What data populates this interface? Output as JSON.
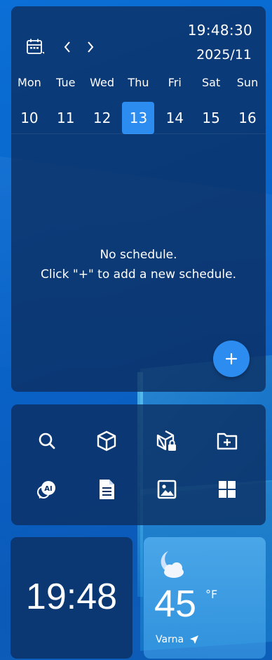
{
  "calendar": {
    "current_time": "19:48:30",
    "current_month": "2025/11",
    "days": [
      {
        "name": "Mon",
        "num": "10"
      },
      {
        "name": "Tue",
        "num": "11"
      },
      {
        "name": "Wed",
        "num": "12"
      },
      {
        "name": "Thu",
        "num": "13"
      },
      {
        "name": "Fri",
        "num": "14"
      },
      {
        "name": "Sat",
        "num": "15"
      },
      {
        "name": "Sun",
        "num": "16"
      }
    ],
    "selected_day": "13",
    "empty_line1": "No schedule.",
    "empty_line2": "Click \"+\" to add a new schedule.",
    "add_label": "+"
  },
  "tools": [
    {
      "icon": "search-icon"
    },
    {
      "icon": "cube-icon"
    },
    {
      "icon": "cube-lock-icon"
    },
    {
      "icon": "folder-add-icon"
    },
    {
      "icon": "ai-chat-icon"
    },
    {
      "icon": "document-icon"
    },
    {
      "icon": "image-icon"
    },
    {
      "icon": "grid-icon"
    }
  ],
  "clock": {
    "time": "19:48"
  },
  "weather": {
    "icon": "moon-cloud-icon",
    "temperature": "45",
    "unit": "°F",
    "city": "Varna"
  },
  "colors": {
    "accent": "#2d8cf0",
    "panel": "#0c2d5f"
  }
}
